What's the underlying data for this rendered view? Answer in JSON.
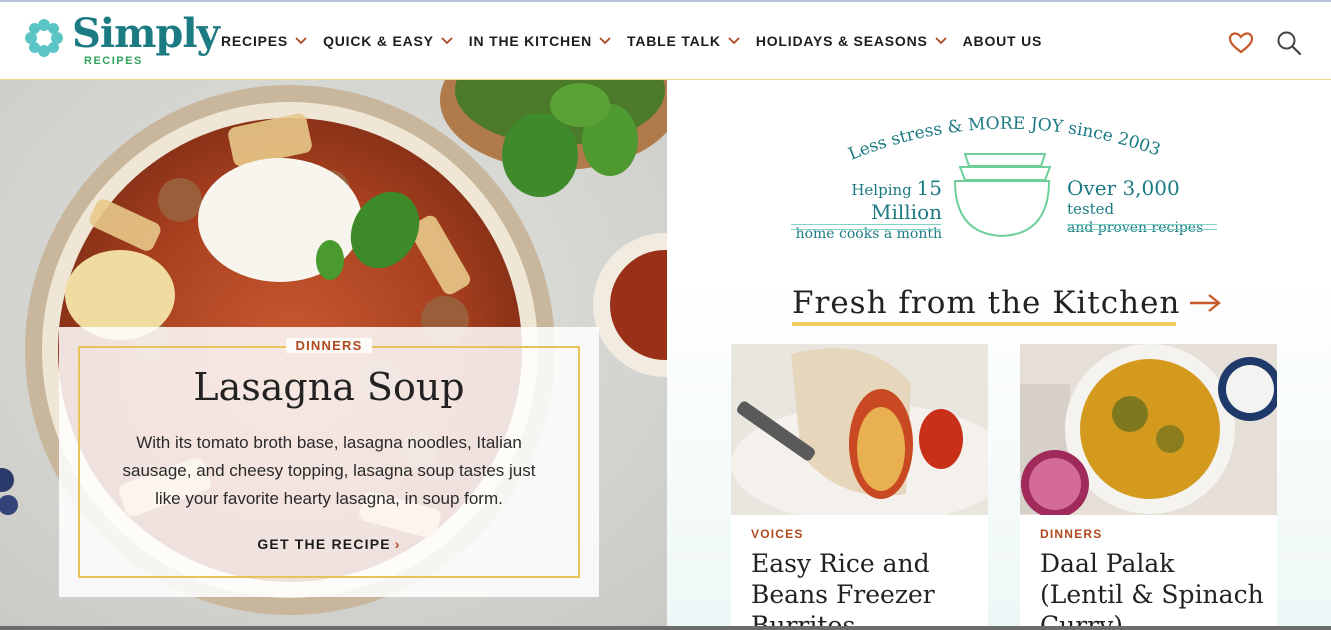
{
  "brand": {
    "name": "Simply",
    "sub": "RECIPES",
    "color": "#1c7a83",
    "accent": "#2fa15b"
  },
  "nav": {
    "items": [
      {
        "label": "RECIPES",
        "dropdown": true
      },
      {
        "label": "QUICK & EASY",
        "dropdown": true
      },
      {
        "label": "IN THE KITCHEN",
        "dropdown": true
      },
      {
        "label": "TABLE TALK",
        "dropdown": true
      },
      {
        "label": "HOLIDAYS & SEASONS",
        "dropdown": true
      },
      {
        "label": "ABOUT US",
        "dropdown": false
      }
    ],
    "chevron_color": "#b0491f"
  },
  "header_icons": {
    "favorites": "heart-icon",
    "search": "search-icon"
  },
  "hero": {
    "category": "DINNERS",
    "title": "Lasagna Soup",
    "description": "With its tomato broth base, lasagna noodles, Italian sausage, and cheesy topping, lasagna soup tastes just like your favorite hearty lasagna, in soup form.",
    "cta": "GET THE RECIPE",
    "cta_chevron": "›"
  },
  "badge": {
    "arc_text": "Less stress & MORE JOY since 2003",
    "left_prefix": "Helping",
    "left_highlight": "15 Million",
    "left_line2": "home cooks a month",
    "right_highlight": "Over 3,000",
    "right_suffix": "tested",
    "right_line2": "and proven recipes"
  },
  "section": {
    "title": "Fresh from the Kitchen",
    "arrow": "→"
  },
  "cards": [
    {
      "category": "VOICES",
      "title": "Easy Rice and Beans Freezer Burritos"
    },
    {
      "category": "DINNERS",
      "title": "Daal Palak (Lentil & Spinach Curry)"
    }
  ]
}
